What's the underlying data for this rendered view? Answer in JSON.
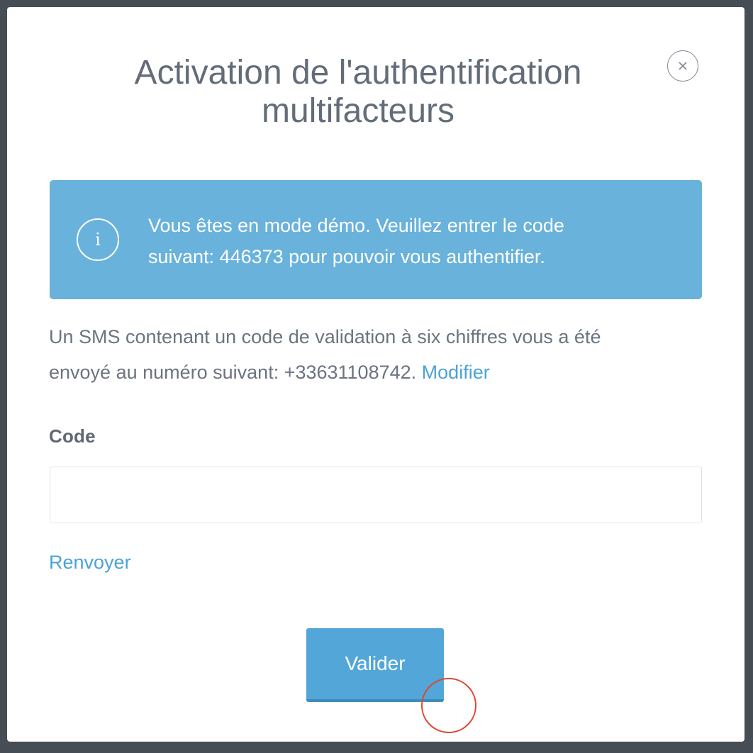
{
  "modal": {
    "title_line1": "Activation de l'authentification",
    "title_line2": "multifacteurs",
    "close_icon": "close-icon"
  },
  "alert": {
    "icon": "info-icon",
    "icon_glyph": "i",
    "line1": "Vous êtes en mode démo. Veuillez entrer le code",
    "line2": "suivant: 446373 pour pouvoir vous authentifier."
  },
  "sms": {
    "line1": "Un SMS contenant un code de validation à six chiffres vous a été",
    "line2": "envoyé au numéro suivant: +33631108742.",
    "modify_link": "Modifier"
  },
  "form": {
    "code_label": "Code",
    "code_value": "",
    "resend_link": "Renvoyer",
    "submit_label": "Valider"
  },
  "colors": {
    "accent": "#53a6d8",
    "alert_bg": "#68b2dc",
    "link": "#4aa3d8",
    "title": "#636d79",
    "click_marker": "#e0452f"
  }
}
